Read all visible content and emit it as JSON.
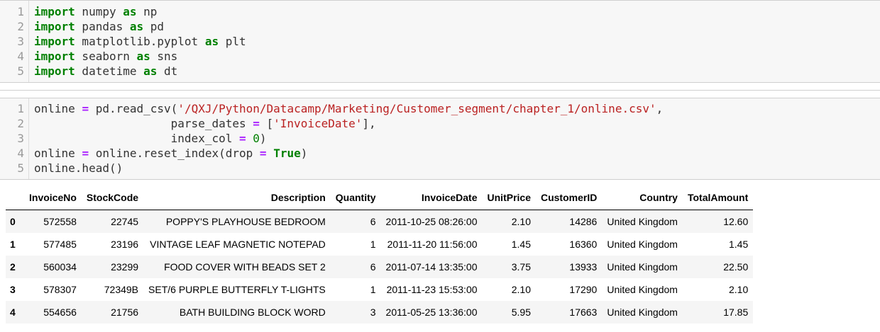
{
  "cell1": {
    "line_numbers": [
      "1",
      "2",
      "3",
      "4",
      "5"
    ],
    "lines": [
      {
        "kw": "import",
        "rest": " numpy ",
        "as": "as",
        "alias": " np"
      },
      {
        "kw": "import",
        "rest": " pandas ",
        "as": "as",
        "alias": " pd"
      },
      {
        "kw": "import",
        "rest": " matplotlib.pyplot ",
        "as": "as",
        "alias": " plt"
      },
      {
        "kw": "import",
        "rest": " seaborn ",
        "as": "as",
        "alias": " sns"
      },
      {
        "kw": "import",
        "rest": " datetime ",
        "as": "as",
        "alias": " dt"
      }
    ]
  },
  "cell2": {
    "line_numbers": [
      "1",
      "2",
      "3",
      "4",
      "5"
    ],
    "line1_a": "online ",
    "line1_eq": "=",
    "line1_b": " pd.read_csv(",
    "line1_str": "'/QXJ/Python/Datacamp/Marketing/Customer_segment/chapter_1/online.csv'",
    "line1_c": ",",
    "line2_a": "                    parse_dates ",
    "line2_eq": "=",
    "line2_b": " [",
    "line2_str": "'InvoiceDate'",
    "line2_c": "],",
    "line3_a": "                    index_col ",
    "line3_eq": "=",
    "line3_b": " ",
    "line3_num": "0",
    "line3_c": ")",
    "line4_a": "online ",
    "line4_eq": "=",
    "line4_b": " online.reset_index(drop ",
    "line4_eq2": "=",
    "line4_sp": " ",
    "line4_kw": "True",
    "line4_c": ")",
    "line5": "online.head()"
  },
  "table": {
    "columns": [
      "",
      "InvoiceNo",
      "StockCode",
      "Description",
      "Quantity",
      "InvoiceDate",
      "UnitPrice",
      "CustomerID",
      "Country",
      "TotalAmount"
    ],
    "rows": [
      [
        "0",
        "572558",
        "22745",
        "POPPY'S PLAYHOUSE BEDROOM",
        "6",
        "2011-10-25 08:26:00",
        "2.10",
        "14286",
        "United Kingdom",
        "12.60"
      ],
      [
        "1",
        "577485",
        "23196",
        "VINTAGE LEAF MAGNETIC NOTEPAD",
        "1",
        "2011-11-20 11:56:00",
        "1.45",
        "16360",
        "United Kingdom",
        "1.45"
      ],
      [
        "2",
        "560034",
        "23299",
        "FOOD COVER WITH BEADS SET 2",
        "6",
        "2011-07-14 13:35:00",
        "3.75",
        "13933",
        "United Kingdom",
        "22.50"
      ],
      [
        "3",
        "578307",
        "72349B",
        "SET/6 PURPLE BUTTERFLY T-LIGHTS",
        "1",
        "2011-11-23 15:53:00",
        "2.10",
        "17290",
        "United Kingdom",
        "2.10"
      ],
      [
        "4",
        "554656",
        "21756",
        "BATH BUILDING BLOCK WORD",
        "3",
        "2011-05-25 13:36:00",
        "5.95",
        "17663",
        "United Kingdom",
        "17.85"
      ]
    ]
  }
}
